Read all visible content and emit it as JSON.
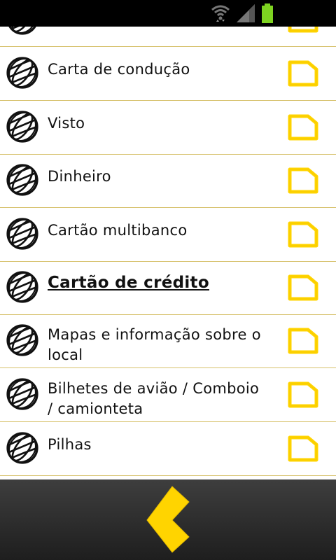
{
  "status_bar": {
    "icons": [
      "wifi-icon",
      "signal-icon",
      "battery-icon"
    ],
    "battery_color": "#7ed321"
  },
  "list": {
    "items": [
      {
        "label": "",
        "checked": false
      },
      {
        "label": "Carta de condução",
        "checked": false
      },
      {
        "label": "Visto",
        "checked": false
      },
      {
        "label": "Dinheiro",
        "checked": false
      },
      {
        "label": "Cartão multibanco",
        "checked": false
      },
      {
        "label": "Cartão de crédito",
        "checked": false,
        "selected": true
      },
      {
        "label": "Mapas e informação sobre o local",
        "checked": false
      },
      {
        "label": "Bilhetes de avião / Comboio / camionteta",
        "checked": false
      },
      {
        "label": "Pilhas",
        "checked": false
      }
    ]
  },
  "bottom_bar": {
    "back_icon": "chevron-left-icon",
    "accent_color": "#ffd400"
  }
}
